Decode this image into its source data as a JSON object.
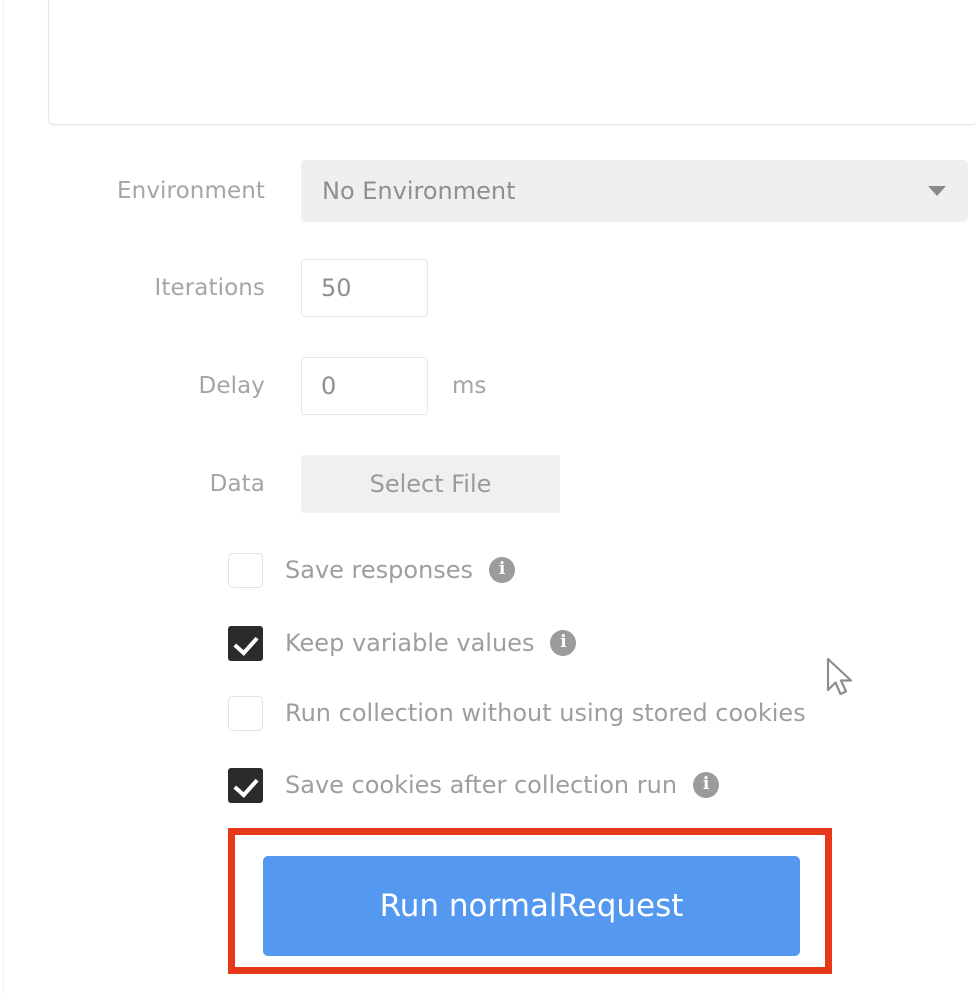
{
  "panel": {
    "request_list_placeholder": ""
  },
  "form": {
    "environment": {
      "label": "Environment",
      "value": "No Environment",
      "caret_icon": "chevron-down-icon"
    },
    "iterations": {
      "label": "Iterations",
      "value": "50"
    },
    "delay": {
      "label": "Delay",
      "value": "0",
      "unit": "ms"
    },
    "data": {
      "label": "Data",
      "button_label": "Select File"
    }
  },
  "options": [
    {
      "label": "Save responses",
      "checked": false,
      "has_info": true,
      "info_icon": "info-icon"
    },
    {
      "label": "Keep variable values",
      "checked": true,
      "has_info": true,
      "info_icon": "info-icon"
    },
    {
      "label": "Run collection without using stored cookies",
      "checked": false,
      "has_info": false,
      "info_icon": ""
    },
    {
      "label": "Save cookies after collection run",
      "checked": true,
      "has_info": true,
      "info_icon": "info-icon"
    }
  ],
  "run": {
    "button_label": "Run normalRequest"
  },
  "annotation": {
    "color": "#e8381a"
  },
  "colors": {
    "accent_blue": "#5498f0",
    "annotation_red": "#e8381a",
    "label_gray": "#a5a5a5",
    "checkbox_checked": "#2b2b2b",
    "info_gray": "#9b9b9b"
  },
  "cursor": {
    "icon": "mouse-pointer-icon"
  }
}
